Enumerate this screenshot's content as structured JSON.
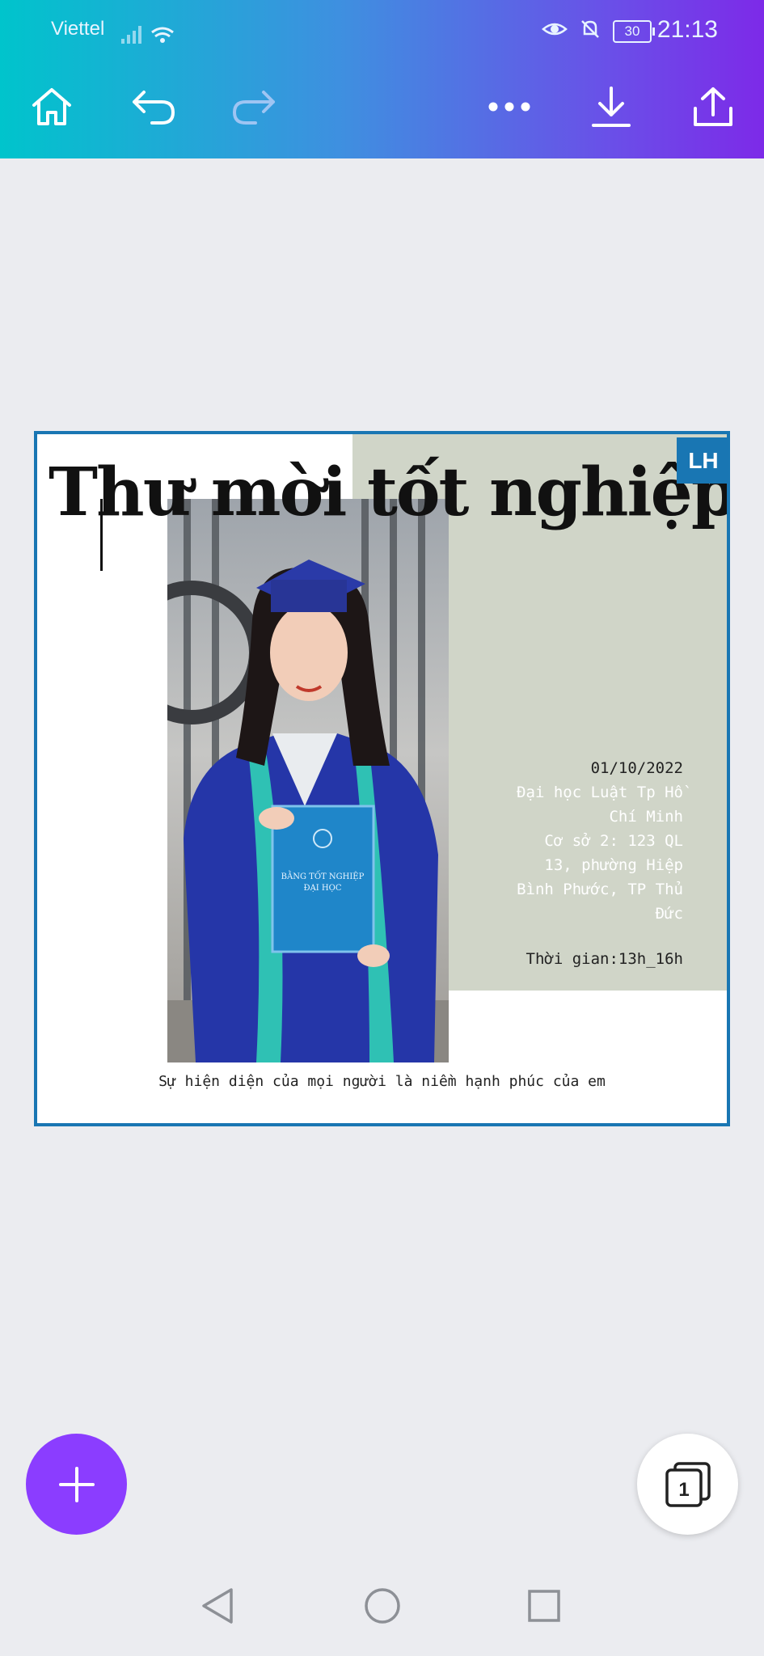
{
  "status_bar": {
    "carrier": "Viettel",
    "battery": "30",
    "time": "21:13"
  },
  "toolbar": {
    "home": "home-icon",
    "undo": "undo-icon",
    "redo": "redo-icon",
    "more": "more-icon",
    "download": "download-icon",
    "share": "share-icon"
  },
  "design": {
    "title": "Thư mời tốt nghiệp",
    "collaborator_badge": "LH",
    "date": "01/10/2022",
    "address_lines": [
      "Đại học Luật Tp Hồ",
      "Chí Minh",
      "Cơ sở 2: 123 QL",
      "13, phường Hiệp",
      "Bình Phước, TP Thủ",
      "Đức"
    ],
    "time": "Thời gian:13h_16h",
    "footer": "Sự hiện diện của mọi người là niềm hạnh phúc của em",
    "diploma_lines": [
      "BẰNG TỐT NGHIỆP",
      "ĐẠI HỌC"
    ]
  },
  "page_count": "1",
  "colors": {
    "accent_purple": "#8b3dff",
    "frame_blue": "#1976b3",
    "sage": "#d0d5c8"
  }
}
